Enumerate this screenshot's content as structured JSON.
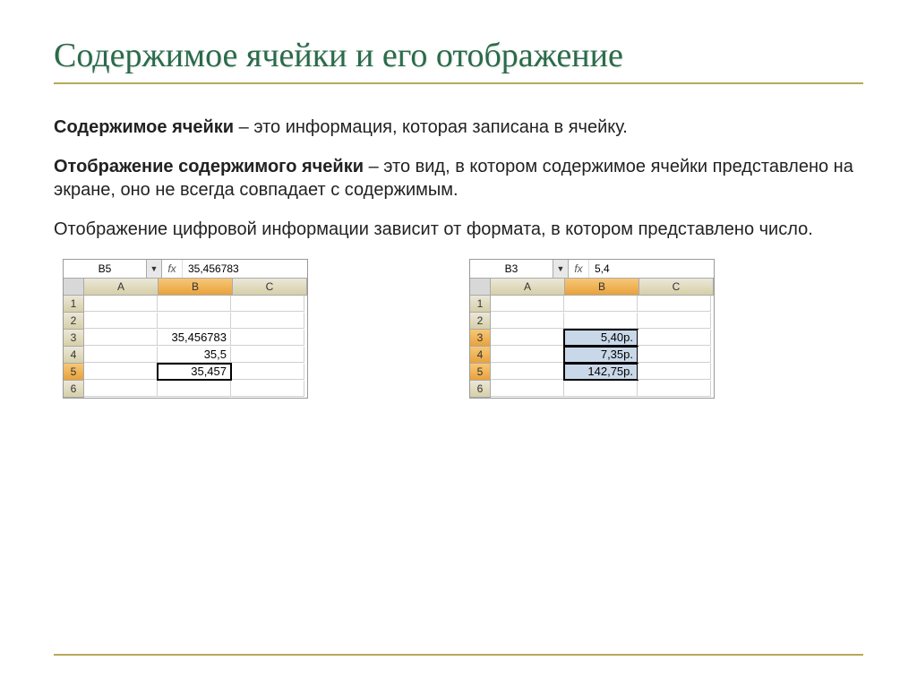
{
  "title": "Содержимое ячейки и его отображение",
  "paragraphs": {
    "p1_bold": "Содержимое ячейки",
    "p1_rest": " – это информация, которая записана в ячейку.",
    "p2_bold": "Отображение содержимого ячейки",
    "p2_rest": " – это вид, в котором содержимое ячейки представлено на экране, оно не всегда совпадает с содержимым.",
    "p3": "Отображение цифровой информации зависит от формата,  в котором представлено число."
  },
  "sheet_left": {
    "name_box": "B5",
    "formula": "35,456783",
    "columns": [
      "A",
      "B",
      "C"
    ],
    "active_col": "B",
    "rows": [
      "1",
      "2",
      "3",
      "4",
      "5",
      "6"
    ],
    "active_rows": [
      "5"
    ],
    "cells": {
      "B3": "35,456783",
      "B4": "35,5",
      "B5": "35,457"
    },
    "selected": "B5"
  },
  "sheet_right": {
    "name_box": "B3",
    "formula": "5,4",
    "columns": [
      "A",
      "B",
      "C"
    ],
    "active_col": "B",
    "rows": [
      "1",
      "2",
      "3",
      "4",
      "5",
      "6"
    ],
    "active_rows": [
      "3",
      "4",
      "5"
    ],
    "cells": {
      "B3": "5,40р.",
      "B4": "7,35р.",
      "B5": "142,75р."
    },
    "range": [
      "B3",
      "B4",
      "B5"
    ]
  }
}
